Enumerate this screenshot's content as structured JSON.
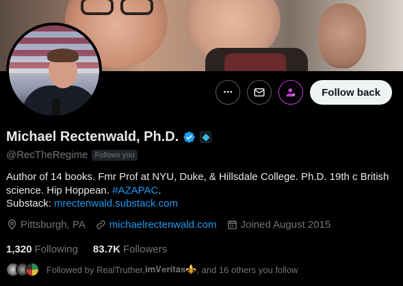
{
  "profile": {
    "name": "Michael Rectenwald, Ph.D.",
    "handle": "@RecTheRegime",
    "follows_you": "Follows you",
    "bio_line1": "Author of 14 books. Fmr Prof at NYU, Duke, & Hillsdale College. Ph.D. 19th c British",
    "bio_line2_text": "science. Hip Hoppean. ",
    "bio_hashtag": "#AZAPAC",
    "bio_line2_end": ".",
    "bio_substack_label": "Substack: ",
    "bio_substack_link": "mrectenwald.substack.com",
    "location": "Pittsburgh, PA",
    "website": "michaelrectenwald.com",
    "joined": "Joined August 2015"
  },
  "stats": {
    "following_count": "1,320",
    "following_label": "Following",
    "followers_count": "83.7K",
    "followers_label": "Followers"
  },
  "followed_by": {
    "prefix": "Followed by RealTruther, ",
    "name2": "𝐢𝐦𝐕𝐞𝐫𝐢𝐭𝐚𝐬",
    "fleur": "⚜️",
    "suffix": ", and 16 others you follow"
  },
  "actions": {
    "more_label": "···",
    "follow_back_label": "Follow back"
  },
  "colors": {
    "accent": "#1d9bf0",
    "subscribe": "#c53bd9",
    "background": "#000000",
    "muted": "#71767b"
  },
  "icons": [
    "more-icon",
    "message-icon",
    "subscribe-icon",
    "verified-icon",
    "location-icon",
    "link-icon",
    "calendar-icon"
  ]
}
